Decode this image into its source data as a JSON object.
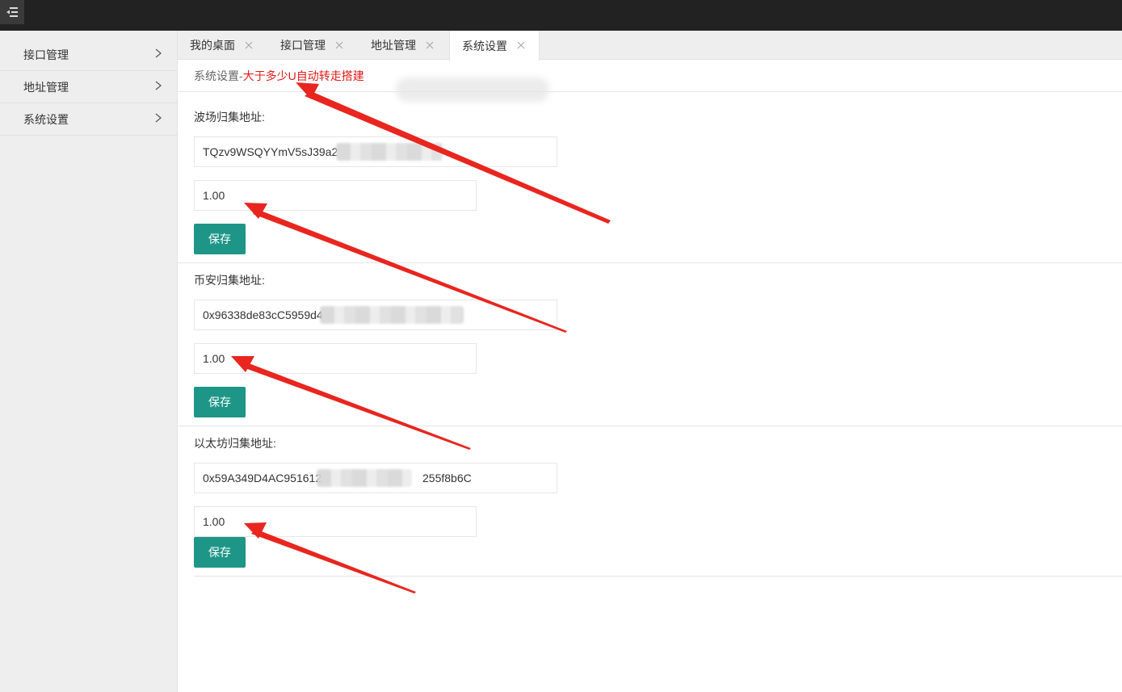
{
  "topbar": {
    "menu_icon": "menu-fold-icon"
  },
  "sidebar": {
    "items": [
      {
        "label": "接口管理"
      },
      {
        "label": "地址管理"
      },
      {
        "label": "系统设置"
      }
    ]
  },
  "tabs": [
    {
      "label": "我的桌面"
    },
    {
      "label": "接口管理"
    },
    {
      "label": "地址管理"
    },
    {
      "label": "系统设置",
      "active": true
    }
  ],
  "breadcrumb": {
    "prefix": "系统设置-",
    "highlight": "大于多少U自动转走搭建"
  },
  "sections": [
    {
      "label": "波场归集地址:",
      "address": "TQzv9WSQYYmV5sJ39a2",
      "amount": "1.00",
      "save": "保存"
    },
    {
      "label": "币安归集地址:",
      "address": "0x96338de83cC5959d4",
      "amount": "1.00",
      "save": "保存"
    },
    {
      "label": "以太坊归集地址:",
      "address": "0x59A349D4AC951612",
      "address_tail": "255f8b6C",
      "amount": "1.00",
      "save": "保存"
    }
  ],
  "colors": {
    "topbar": "#222222",
    "sidebar": "#eeeeee",
    "primary_button": "#1e9687",
    "highlight_text": "#e21b1b",
    "annotation_arrow": "#e8261f"
  }
}
